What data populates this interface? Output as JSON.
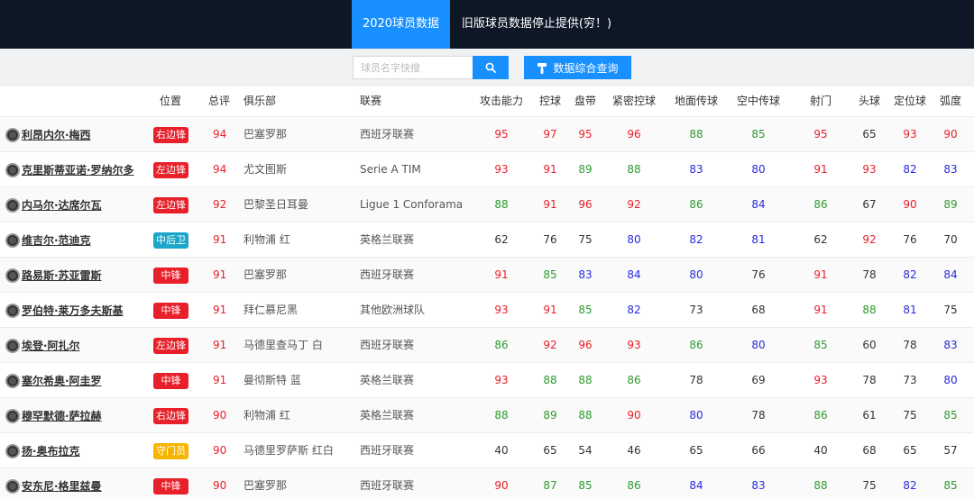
{
  "nav": {
    "tabs": [
      {
        "label": "2020球员数据"
      },
      {
        "label": "旧版球员数据停止提供(穷！)"
      }
    ]
  },
  "search": {
    "placeholder": "球员名字快搜",
    "query_button": "数据综合查询",
    "search_icon": "search-icon",
    "query_icon": "paint-roller-icon"
  },
  "colors": {
    "nav_bg": "#0d1726",
    "accent": "#1890ff",
    "high": "#e8202a",
    "good": "#2e9a2e",
    "mid": "#2a2ae0",
    "pos_forward": "#e8202a",
    "pos_cb": "#1ca6c9",
    "pos_gk": "#f7b500"
  },
  "table": {
    "headers": [
      "位置",
      "总评",
      "俱乐部",
      "联赛",
      "攻击能力",
      "控球",
      "盘带",
      "紧密控球",
      "地面传球",
      "空中传球",
      "射门",
      "头球",
      "定位球",
      "弧度"
    ],
    "rows": [
      {
        "name": "利昂内尔·梅西",
        "pos": "右边锋",
        "pos_color": "#e8202a",
        "overall": "94",
        "club": "巴塞罗那",
        "league": "西班牙联赛",
        "stats": [
          "95",
          "97",
          "95",
          "96",
          "88",
          "85",
          "95",
          "65",
          "93",
          "90"
        ],
        "tones": [
          "r",
          "r",
          "r",
          "r",
          "g",
          "g",
          "r",
          "k",
          "r",
          "r"
        ]
      },
      {
        "name": "克里斯蒂亚诺·罗纳尔多",
        "pos": "左边锋",
        "pos_color": "#e8202a",
        "overall": "94",
        "club": "尤文图斯",
        "league": "Serie A TIM",
        "stats": [
          "93",
          "91",
          "89",
          "88",
          "83",
          "80",
          "91",
          "93",
          "82",
          "83"
        ],
        "tones": [
          "r",
          "r",
          "g",
          "g",
          "b",
          "b",
          "r",
          "r",
          "b",
          "b"
        ]
      },
      {
        "name": "内马尔·达席尔瓦",
        "pos": "左边锋",
        "pos_color": "#e8202a",
        "overall": "92",
        "club": "巴黎圣日耳曼",
        "league": "Ligue 1 Conforama",
        "stats": [
          "88",
          "91",
          "96",
          "92",
          "86",
          "84",
          "86",
          "67",
          "90",
          "89"
        ],
        "tones": [
          "g",
          "r",
          "r",
          "r",
          "g",
          "b",
          "g",
          "k",
          "r",
          "g"
        ]
      },
      {
        "name": "维吉尔·范迪克",
        "pos": "中后卫",
        "pos_color": "#1ca6c9",
        "overall": "91",
        "club": "利物浦 红",
        "league": "英格兰联赛",
        "stats": [
          "62",
          "76",
          "75",
          "80",
          "82",
          "81",
          "62",
          "92",
          "76",
          "70"
        ],
        "tones": [
          "k",
          "k",
          "k",
          "b",
          "b",
          "b",
          "k",
          "r",
          "k",
          "k"
        ]
      },
      {
        "name": "路易斯·苏亚雷斯",
        "pos": "中锋",
        "pos_color": "#e8202a",
        "overall": "91",
        "club": "巴塞罗那",
        "league": "西班牙联赛",
        "stats": [
          "91",
          "85",
          "83",
          "84",
          "80",
          "76",
          "91",
          "78",
          "82",
          "84"
        ],
        "tones": [
          "r",
          "g",
          "b",
          "b",
          "b",
          "k",
          "r",
          "k",
          "b",
          "b"
        ]
      },
      {
        "name": "罗伯特·莱万多夫斯基",
        "pos": "中锋",
        "pos_color": "#e8202a",
        "overall": "91",
        "club": "拜仁慕尼黑",
        "league": "其他欧洲球队",
        "stats": [
          "93",
          "91",
          "85",
          "82",
          "73",
          "68",
          "91",
          "88",
          "81",
          "75"
        ],
        "tones": [
          "r",
          "r",
          "g",
          "b",
          "k",
          "k",
          "r",
          "g",
          "b",
          "k"
        ]
      },
      {
        "name": "埃登·阿扎尔",
        "pos": "左边锋",
        "pos_color": "#e8202a",
        "overall": "91",
        "club": "马德里查马丁 白",
        "league": "西班牙联赛",
        "stats": [
          "86",
          "92",
          "96",
          "93",
          "86",
          "80",
          "85",
          "60",
          "78",
          "83"
        ],
        "tones": [
          "g",
          "r",
          "r",
          "r",
          "g",
          "b",
          "g",
          "k",
          "k",
          "b"
        ]
      },
      {
        "name": "塞尔希奥·阿圭罗",
        "pos": "中锋",
        "pos_color": "#e8202a",
        "overall": "91",
        "club": "曼彻斯特 蓝",
        "league": "英格兰联赛",
        "stats": [
          "93",
          "88",
          "88",
          "86",
          "78",
          "69",
          "93",
          "78",
          "73",
          "80"
        ],
        "tones": [
          "r",
          "g",
          "g",
          "g",
          "k",
          "k",
          "r",
          "k",
          "k",
          "b"
        ]
      },
      {
        "name": "穆罕默德·萨拉赫",
        "pos": "右边锋",
        "pos_color": "#e8202a",
        "overall": "90",
        "club": "利物浦 红",
        "league": "英格兰联赛",
        "stats": [
          "88",
          "89",
          "88",
          "90",
          "80",
          "78",
          "86",
          "61",
          "75",
          "85"
        ],
        "tones": [
          "g",
          "g",
          "g",
          "r",
          "b",
          "k",
          "g",
          "k",
          "k",
          "g"
        ]
      },
      {
        "name": "扬·奥布拉克",
        "pos": "守门员",
        "pos_color": "#f7b500",
        "overall": "90",
        "club": "马德里罗萨斯 红白",
        "league": "西班牙联赛",
        "stats": [
          "40",
          "65",
          "54",
          "46",
          "65",
          "66",
          "40",
          "68",
          "65",
          "57"
        ],
        "tones": [
          "k",
          "k",
          "k",
          "k",
          "k",
          "k",
          "k",
          "k",
          "k",
          "k"
        ]
      },
      {
        "name": "安东尼·格里兹曼",
        "pos": "中锋",
        "pos_color": "#e8202a",
        "overall": "90",
        "club": "巴塞罗那",
        "league": "西班牙联赛",
        "stats": [
          "90",
          "87",
          "85",
          "86",
          "84",
          "83",
          "88",
          "75",
          "82",
          "85"
        ],
        "tones": [
          "r",
          "g",
          "g",
          "g",
          "b",
          "b",
          "g",
          "k",
          "b",
          "g"
        ]
      }
    ]
  }
}
